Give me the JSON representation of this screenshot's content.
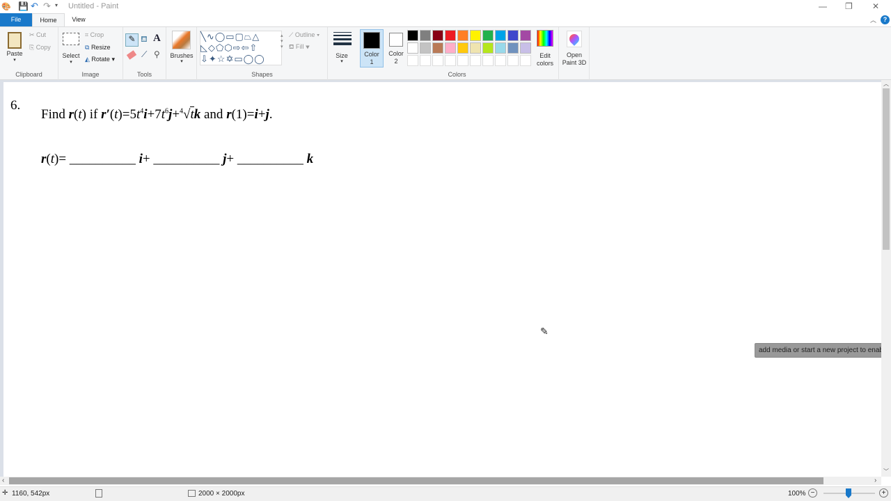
{
  "window": {
    "title": "Untitled - Paint"
  },
  "tabs": [
    {
      "label": "File"
    },
    {
      "label": "Home"
    },
    {
      "label": "View"
    }
  ],
  "ribbon": {
    "clipboard": {
      "label": "Clipboard",
      "paste": "Paste",
      "cut": "Cut",
      "copy": "Copy"
    },
    "image": {
      "label": "Image",
      "select": "Select",
      "crop": "Crop",
      "resize": "Resize",
      "rotate": "Rotate"
    },
    "tools": {
      "label": "Tools"
    },
    "brushes": {
      "label": "Brushes"
    },
    "shapes": {
      "label": "Shapes",
      "outline": "Outline",
      "fill": "Fill"
    },
    "size": {
      "label": "Size"
    },
    "colors": {
      "label": "Colors",
      "color1": "Color 1",
      "color2": "Color 2",
      "edit": "Edit colors",
      "color1_value": "#000000",
      "color2_value": "#ffffff",
      "palette_row1": [
        "#000000",
        "#7f7f7f",
        "#880015",
        "#ed1c24",
        "#ff7f27",
        "#fff200",
        "#22b14c",
        "#00a2e8",
        "#3f48cc",
        "#a349a4"
      ],
      "palette_row2": [
        "#ffffff",
        "#c3c3c3",
        "#b97a57",
        "#ffaec9",
        "#ffc90e",
        "#efe4b0",
        "#b5e61d",
        "#99d9ea",
        "#7092be",
        "#c8bfe7"
      ]
    },
    "paint3d": {
      "label": "Open Paint 3D"
    }
  },
  "canvas": {
    "problem_number": "6.",
    "question": {
      "find": "Find",
      "r": "r",
      "lp": "(",
      "t": "t",
      "rp": ")",
      "if": "if",
      "rprime": "r′",
      "eq": "=",
      "c1": "5",
      "e1": "4",
      "i": "i",
      "plus": "+",
      "c2": "7",
      "e2": "6",
      "j": "j",
      "root_index": "4",
      "k": "k",
      "and": "and",
      "one": "1",
      "dot": "."
    },
    "answer": {
      "lhs_r": "r",
      "blank": "__________",
      "i": "i",
      "j": "j",
      "k": "k",
      "plus": "+",
      "eq": "="
    }
  },
  "tooltip": "add media or start a new project to enable",
  "status": {
    "cursor_pos": "1160, 542px",
    "canvas_size": "2000 × 2000px",
    "zoom": "100%",
    "zoom_percent": 100
  }
}
